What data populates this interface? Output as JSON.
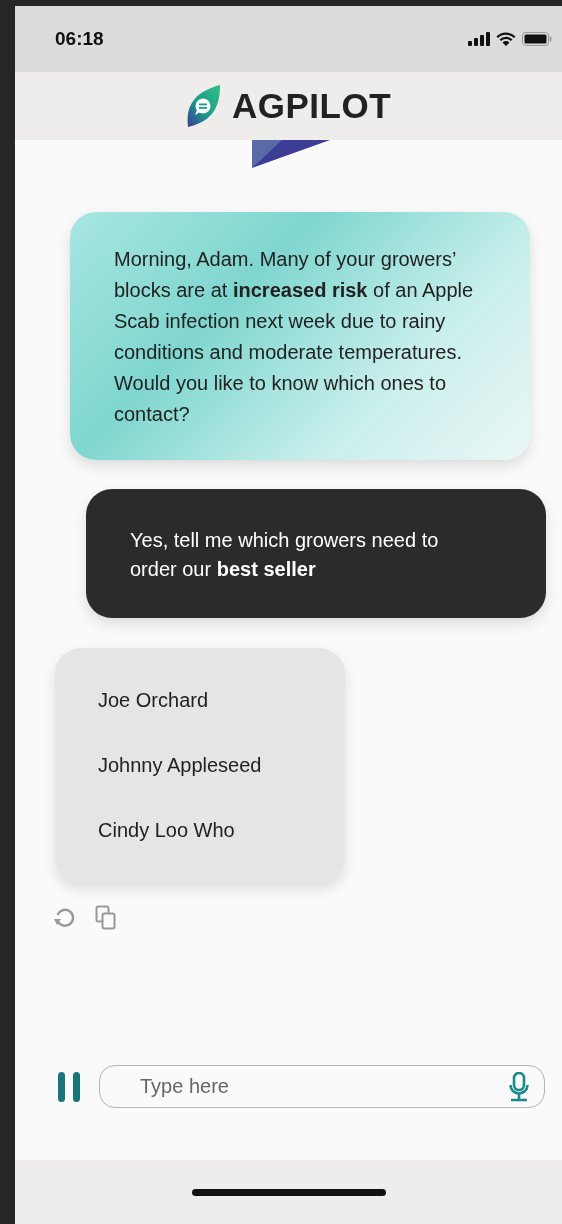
{
  "status_bar": {
    "time": "06:18"
  },
  "header": {
    "title": "AGPILOT"
  },
  "messages": [
    {
      "kind": "assistant",
      "text": "Morning, Adam. Many of your growers’ blocks are at **increased risk** of an Apple Scab infection next week due to rainy conditions and moderate temperatures. Would you like to know which ones to contact?"
    },
    {
      "kind": "user",
      "text": "Yes, tell me which growers need to order our **best seller**"
    },
    {
      "kind": "list",
      "items": [
        "Joe Orchard",
        "Johnny Appleseed",
        "Cindy Loo Who"
      ]
    }
  ],
  "composer": {
    "placeholder": "Type here"
  }
}
